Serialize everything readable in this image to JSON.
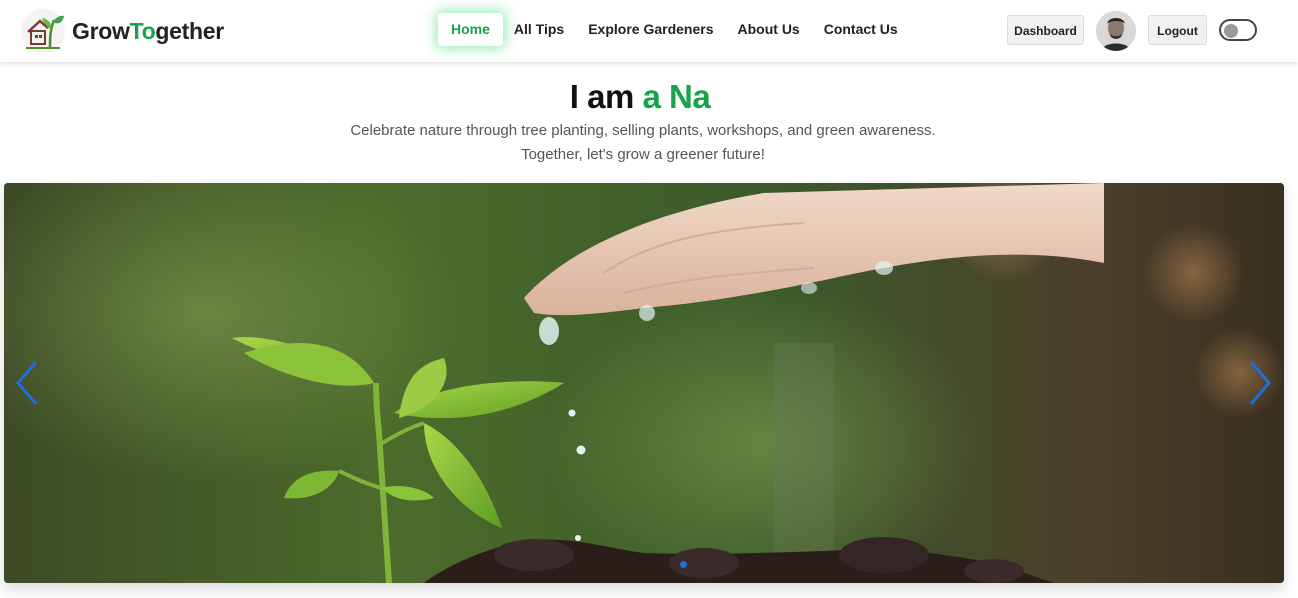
{
  "navbar": {
    "brand_prefix": "Grow",
    "brand_accent": "To",
    "brand_suffix": "gether",
    "links": [
      {
        "label": "Home",
        "active": true
      },
      {
        "label": "All Tips"
      },
      {
        "label": "Explore Gardeners"
      },
      {
        "label": "About Us"
      },
      {
        "label": "Contact Us"
      }
    ],
    "dashboard_label": "Dashboard",
    "logout_label": "Logout",
    "theme_toggle_on": false
  },
  "hero": {
    "title_plain": "I am",
    "title_accent": "a Na",
    "subtitle_line1": "Celebrate nature through tree planting, selling plants, workshops, and green awareness.",
    "subtitle_line2": "Together, let's grow a greener future!"
  },
  "carousel": {
    "active_slide": 1,
    "image_subject": "hand watering seedling in soil"
  },
  "colors": {
    "accent": "#16a34a",
    "arrow": "#1d6fe0"
  }
}
